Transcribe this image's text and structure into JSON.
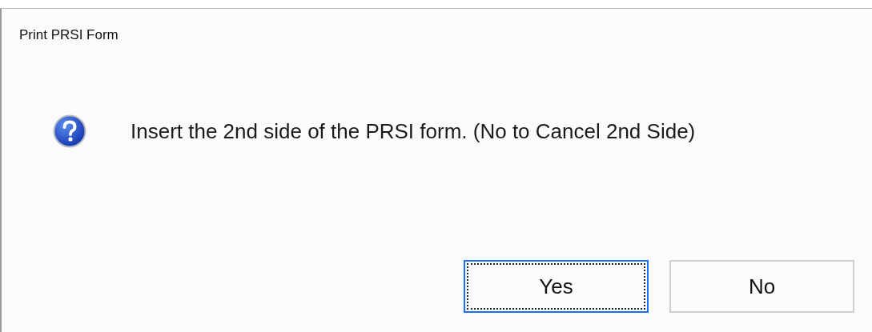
{
  "window": {
    "title": "Print PRSI Form"
  },
  "message": {
    "text": "Insert the 2nd side of the PRSI form. (No to Cancel 2nd Side)"
  },
  "buttons": [
    {
      "label": "Yes",
      "focused": true
    },
    {
      "label": "No",
      "focused": false
    }
  ]
}
